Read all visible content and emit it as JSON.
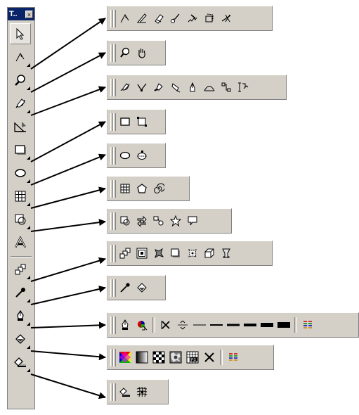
{
  "toolbox": {
    "title": "T..",
    "close_glyph": "×",
    "tools": [
      {
        "icon": "pick-tool-icon",
        "flyout": false
      },
      {
        "icon": "shape-tool-icon",
        "flyout": true
      },
      {
        "icon": "zoom-tool-icon",
        "flyout": true
      },
      {
        "icon": "freehand-tool-icon",
        "flyout": true
      },
      {
        "icon": "smart-fill-tool-icon",
        "flyout": false
      },
      {
        "icon": "rectangle-tool-icon",
        "flyout": true
      },
      {
        "icon": "ellipse-tool-icon",
        "flyout": true
      },
      {
        "icon": "polygon-tool-icon",
        "flyout": true
      },
      {
        "icon": "basic-shapes-tool-icon",
        "flyout": true
      },
      {
        "icon": "text-tool-icon",
        "flyout": false
      },
      {
        "icon": "interactive-blend-tool-icon",
        "flyout": true
      },
      {
        "icon": "eyedropper-tool-icon",
        "flyout": true
      },
      {
        "icon": "outline-tool-icon",
        "flyout": true
      },
      {
        "icon": "fill-tool-icon",
        "flyout": true
      },
      {
        "icon": "interactive-fill-tool-icon",
        "flyout": true
      }
    ]
  },
  "flyouts": [
    {
      "name": "shape-edit-flyout",
      "icons": [
        "shape-icon",
        "knife-icon",
        "eraser-icon",
        "smudge-icon",
        "roughen-icon",
        "free-transform-icon",
        "virtual-segment-delete-icon"
      ]
    },
    {
      "name": "zoom-flyout",
      "icons": [
        "zoom-icon",
        "hand-icon"
      ]
    },
    {
      "name": "curve-flyout",
      "icons": [
        "freehand-icon",
        "bezier-icon",
        "artistic-media-icon",
        "pen-icon",
        "polyline-icon",
        "3-point-curve-icon",
        "connector-icon",
        "dimension-icon"
      ]
    },
    {
      "name": "rectangle-flyout",
      "icons": [
        "rectangle-icon",
        "3-point-rectangle-icon"
      ]
    },
    {
      "name": "ellipse-flyout",
      "icons": [
        "ellipse-icon",
        "3-point-ellipse-icon"
      ]
    },
    {
      "name": "object-flyout",
      "icons": [
        "graph-paper-icon",
        "polygon-icon",
        "spiral-icon"
      ]
    },
    {
      "name": "perfect-shapes-flyout",
      "icons": [
        "basic-shapes-icon",
        "arrow-shapes-icon",
        "flowchart-shapes-icon",
        "star-shapes-icon",
        "callout-shapes-icon"
      ]
    },
    {
      "name": "interactive-tools-flyout",
      "icons": [
        "blend-icon",
        "contour-icon",
        "distort-icon",
        "drop-shadow-icon",
        "envelope-icon",
        "extrude-icon",
        "transparency-icon"
      ]
    },
    {
      "name": "eyedropper-flyout",
      "icons": [
        "eyedropper-icon",
        "paintbucket-icon"
      ]
    },
    {
      "name": "outline-flyout",
      "icons": [
        "outline-pen-icon",
        "outline-color-icon",
        "no-outline-icon",
        "hairline-outline-icon",
        "thin-line-1",
        "line-2",
        "line-3",
        "line-4",
        "line-5",
        "line-6",
        "color-docker-icon"
      ]
    },
    {
      "name": "fill-flyout",
      "icons": [
        "fill-color-icon",
        "fountain-fill-icon",
        "pattern-fill-icon",
        "texture-fill-icon",
        "postscript-fill-icon",
        "no-fill-icon",
        "color-docker-icon"
      ]
    },
    {
      "name": "interactive-fill-flyout",
      "icons": [
        "interactive-fill-icon",
        "mesh-fill-icon"
      ]
    }
  ]
}
